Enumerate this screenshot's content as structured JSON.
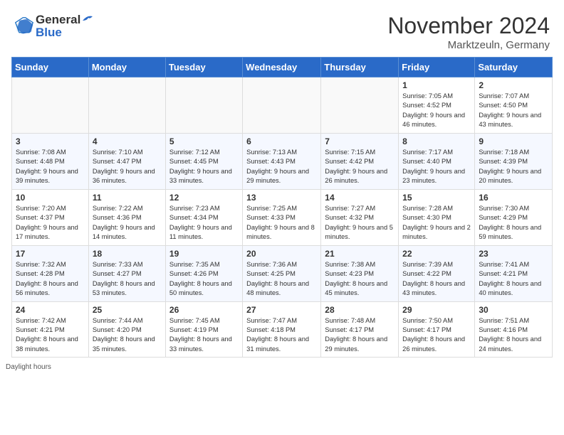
{
  "header": {
    "logo_line1": "General",
    "logo_line2": "Blue",
    "month_title": "November 2024",
    "location": "Marktzeuln, Germany"
  },
  "weekdays": [
    "Sunday",
    "Monday",
    "Tuesday",
    "Wednesday",
    "Thursday",
    "Friday",
    "Saturday"
  ],
  "weeks": [
    [
      {
        "day": "",
        "info": ""
      },
      {
        "day": "",
        "info": ""
      },
      {
        "day": "",
        "info": ""
      },
      {
        "day": "",
        "info": ""
      },
      {
        "day": "",
        "info": ""
      },
      {
        "day": "1",
        "info": "Sunrise: 7:05 AM\nSunset: 4:52 PM\nDaylight: 9 hours and 46 minutes."
      },
      {
        "day": "2",
        "info": "Sunrise: 7:07 AM\nSunset: 4:50 PM\nDaylight: 9 hours and 43 minutes."
      }
    ],
    [
      {
        "day": "3",
        "info": "Sunrise: 7:08 AM\nSunset: 4:48 PM\nDaylight: 9 hours and 39 minutes."
      },
      {
        "day": "4",
        "info": "Sunrise: 7:10 AM\nSunset: 4:47 PM\nDaylight: 9 hours and 36 minutes."
      },
      {
        "day": "5",
        "info": "Sunrise: 7:12 AM\nSunset: 4:45 PM\nDaylight: 9 hours and 33 minutes."
      },
      {
        "day": "6",
        "info": "Sunrise: 7:13 AM\nSunset: 4:43 PM\nDaylight: 9 hours and 29 minutes."
      },
      {
        "day": "7",
        "info": "Sunrise: 7:15 AM\nSunset: 4:42 PM\nDaylight: 9 hours and 26 minutes."
      },
      {
        "day": "8",
        "info": "Sunrise: 7:17 AM\nSunset: 4:40 PM\nDaylight: 9 hours and 23 minutes."
      },
      {
        "day": "9",
        "info": "Sunrise: 7:18 AM\nSunset: 4:39 PM\nDaylight: 9 hours and 20 minutes."
      }
    ],
    [
      {
        "day": "10",
        "info": "Sunrise: 7:20 AM\nSunset: 4:37 PM\nDaylight: 9 hours and 17 minutes."
      },
      {
        "day": "11",
        "info": "Sunrise: 7:22 AM\nSunset: 4:36 PM\nDaylight: 9 hours and 14 minutes."
      },
      {
        "day": "12",
        "info": "Sunrise: 7:23 AM\nSunset: 4:34 PM\nDaylight: 9 hours and 11 minutes."
      },
      {
        "day": "13",
        "info": "Sunrise: 7:25 AM\nSunset: 4:33 PM\nDaylight: 9 hours and 8 minutes."
      },
      {
        "day": "14",
        "info": "Sunrise: 7:27 AM\nSunset: 4:32 PM\nDaylight: 9 hours and 5 minutes."
      },
      {
        "day": "15",
        "info": "Sunrise: 7:28 AM\nSunset: 4:30 PM\nDaylight: 9 hours and 2 minutes."
      },
      {
        "day": "16",
        "info": "Sunrise: 7:30 AM\nSunset: 4:29 PM\nDaylight: 8 hours and 59 minutes."
      }
    ],
    [
      {
        "day": "17",
        "info": "Sunrise: 7:32 AM\nSunset: 4:28 PM\nDaylight: 8 hours and 56 minutes."
      },
      {
        "day": "18",
        "info": "Sunrise: 7:33 AM\nSunset: 4:27 PM\nDaylight: 8 hours and 53 minutes."
      },
      {
        "day": "19",
        "info": "Sunrise: 7:35 AM\nSunset: 4:26 PM\nDaylight: 8 hours and 50 minutes."
      },
      {
        "day": "20",
        "info": "Sunrise: 7:36 AM\nSunset: 4:25 PM\nDaylight: 8 hours and 48 minutes."
      },
      {
        "day": "21",
        "info": "Sunrise: 7:38 AM\nSunset: 4:23 PM\nDaylight: 8 hours and 45 minutes."
      },
      {
        "day": "22",
        "info": "Sunrise: 7:39 AM\nSunset: 4:22 PM\nDaylight: 8 hours and 43 minutes."
      },
      {
        "day": "23",
        "info": "Sunrise: 7:41 AM\nSunset: 4:21 PM\nDaylight: 8 hours and 40 minutes."
      }
    ],
    [
      {
        "day": "24",
        "info": "Sunrise: 7:42 AM\nSunset: 4:21 PM\nDaylight: 8 hours and 38 minutes."
      },
      {
        "day": "25",
        "info": "Sunrise: 7:44 AM\nSunset: 4:20 PM\nDaylight: 8 hours and 35 minutes."
      },
      {
        "day": "26",
        "info": "Sunrise: 7:45 AM\nSunset: 4:19 PM\nDaylight: 8 hours and 33 minutes."
      },
      {
        "day": "27",
        "info": "Sunrise: 7:47 AM\nSunset: 4:18 PM\nDaylight: 8 hours and 31 minutes."
      },
      {
        "day": "28",
        "info": "Sunrise: 7:48 AM\nSunset: 4:17 PM\nDaylight: 8 hours and 29 minutes."
      },
      {
        "day": "29",
        "info": "Sunrise: 7:50 AM\nSunset: 4:17 PM\nDaylight: 8 hours and 26 minutes."
      },
      {
        "day": "30",
        "info": "Sunrise: 7:51 AM\nSunset: 4:16 PM\nDaylight: 8 hours and 24 minutes."
      }
    ]
  ],
  "footer": {
    "daylight_note": "Daylight hours"
  }
}
